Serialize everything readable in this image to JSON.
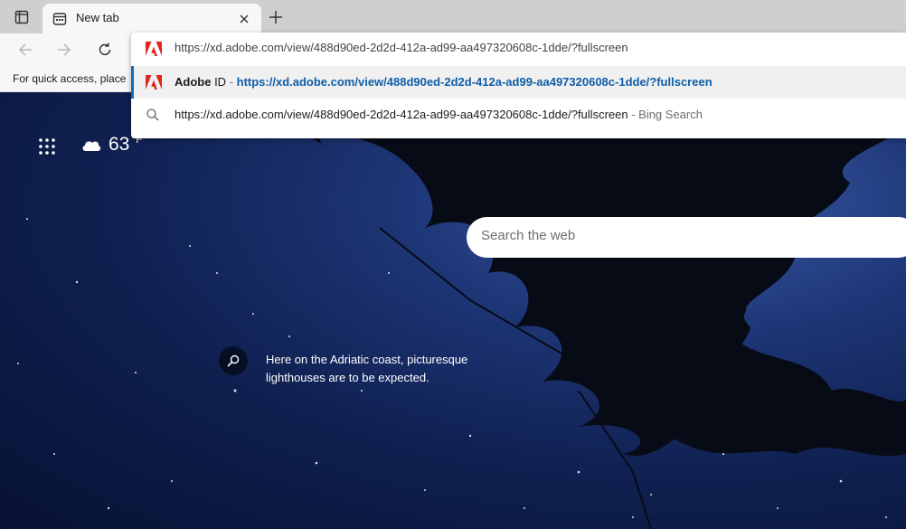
{
  "tab": {
    "title": "New tab"
  },
  "favorites_bar": {
    "hint": "For quick access, place your favorites here"
  },
  "omnibox": {
    "value": "https://xd.adobe.com/view/488d90ed-2d2d-412a-ad99-aa497320608c-1dde/?fullscreen",
    "suggestions": [
      {
        "name": "Adobe",
        "suffix": " ID",
        "separator": " - ",
        "url": "https://xd.adobe.com/view/488d90ed-2d2d-412a-ad99-aa497320608c-1dde/?fullscreen",
        "icon": "adobe-icon"
      },
      {
        "query": "https://xd.adobe.com/view/488d90ed-2d2d-412a-ad99-aa497320608c-1dde/?fullscreen",
        "suffix": " - Bing Search",
        "icon": "search-icon"
      }
    ]
  },
  "ntp": {
    "weather": {
      "temp": "63",
      "unit": "°F",
      "icon": "cloud-icon"
    },
    "search_placeholder": "Search the web",
    "caption": "Here on the Adriatic coast, picturesque lighthouses are to be expected."
  },
  "colors": {
    "adobe_red": "#e1251b",
    "link_blue": "#0f5ea8",
    "accent": "#0f6cbd"
  }
}
